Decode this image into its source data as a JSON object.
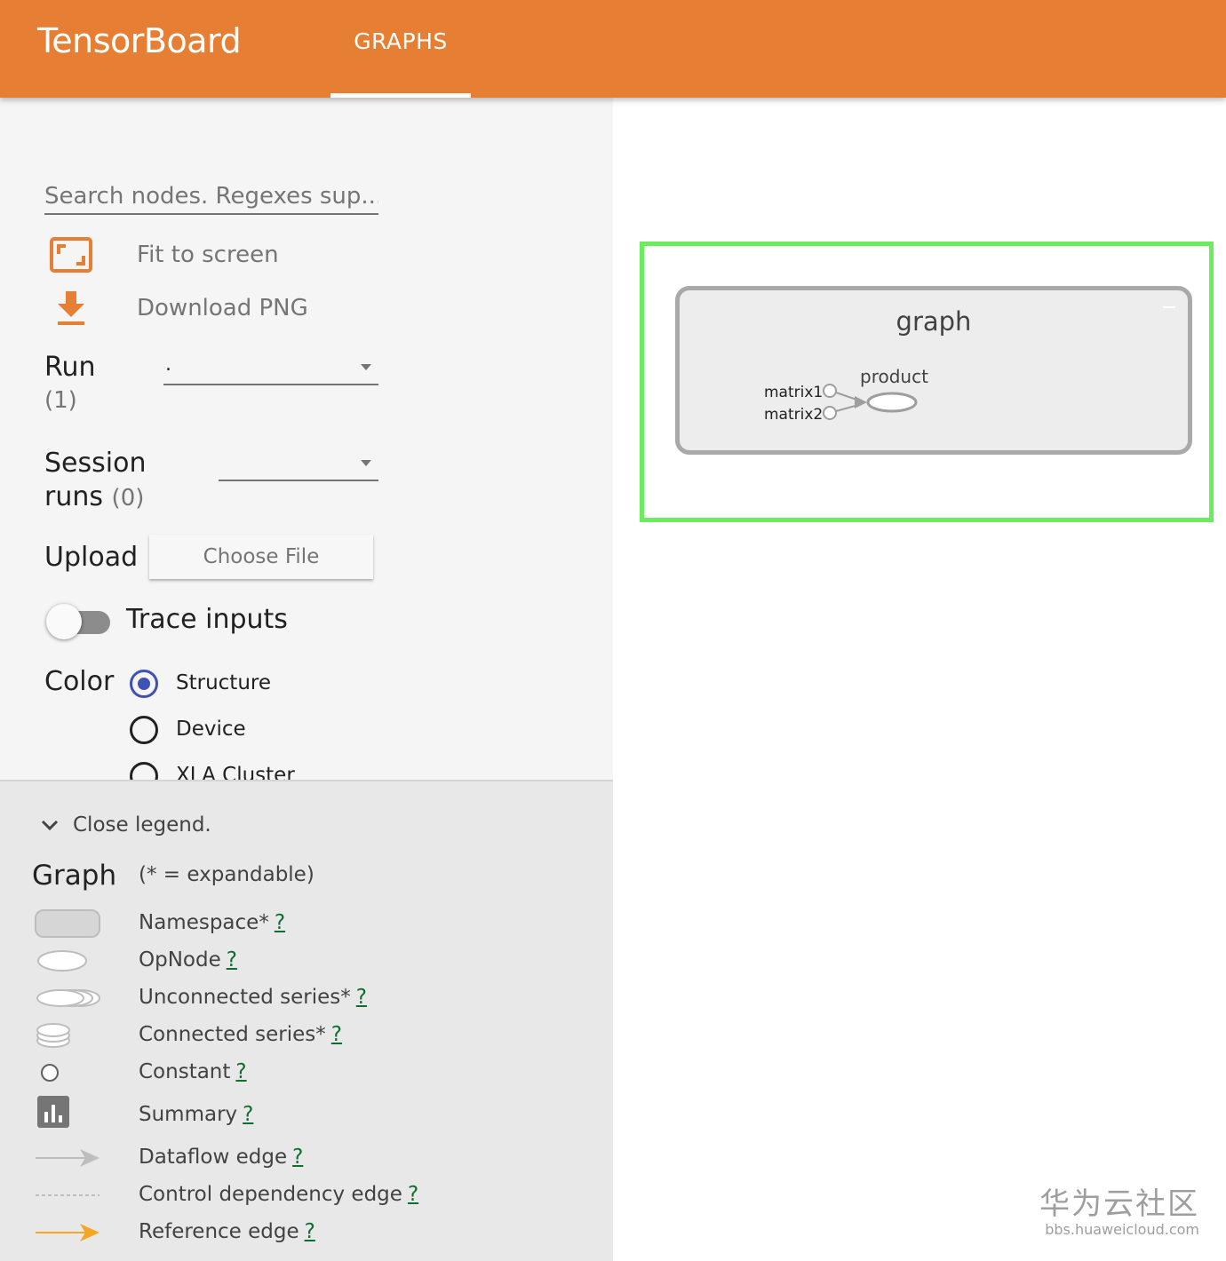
{
  "header": {
    "brand": "TensorBoard",
    "tabs": [
      {
        "label": "GRAPHS",
        "active": true
      }
    ],
    "background_color": "#e67f33"
  },
  "sidebar": {
    "search": {
      "placeholder": "Search nodes. Regexes sup..."
    },
    "actions": [
      {
        "label": "Fit to screen",
        "icon": "fit-to-screen-icon"
      },
      {
        "label": "Download PNG",
        "icon": "download-icon"
      }
    ],
    "run": {
      "label": "Run",
      "count": "(1)",
      "selected": "."
    },
    "session_runs": {
      "label_line1": "Session",
      "label_line2": "runs",
      "count": "(0)",
      "selected": ""
    },
    "upload": {
      "label": "Upload",
      "button": "Choose File"
    },
    "trace_inputs": {
      "label": "Trace inputs",
      "enabled": false
    },
    "color": {
      "label": "Color",
      "options": [
        {
          "label": "Structure",
          "checked": true
        },
        {
          "label": "Device",
          "checked": false
        },
        {
          "label": "XLA Cluster",
          "checked": false
        }
      ],
      "accent": "#3f51b5"
    }
  },
  "legend": {
    "toggle_label": "Close legend.",
    "title": "Graph",
    "subtitle": "(* = expandable)",
    "help": "?",
    "items": [
      {
        "label": "Namespace*",
        "icon": "namespace-icon"
      },
      {
        "label": "OpNode",
        "icon": "opnode-icon"
      },
      {
        "label": "Unconnected series*",
        "icon": "unconnected-series-icon"
      },
      {
        "label": "Connected series*",
        "icon": "connected-series-icon"
      },
      {
        "label": "Constant",
        "icon": "constant-icon"
      },
      {
        "label": "Summary",
        "icon": "summary-icon"
      },
      {
        "label": "Dataflow edge",
        "icon": "dataflow-edge-icon"
      },
      {
        "label": "Control dependency edge",
        "icon": "control-dependency-edge-icon"
      },
      {
        "label": "Reference edge",
        "icon": "reference-edge-icon"
      }
    ]
  },
  "graph": {
    "namespace_title": "graph",
    "inputs": [
      "matrix1",
      "matrix2"
    ],
    "op": "product",
    "minimap_color": "#6bec5d"
  },
  "watermark": {
    "brand": "华为云社区",
    "url": "bbs.huaweicloud.com"
  }
}
